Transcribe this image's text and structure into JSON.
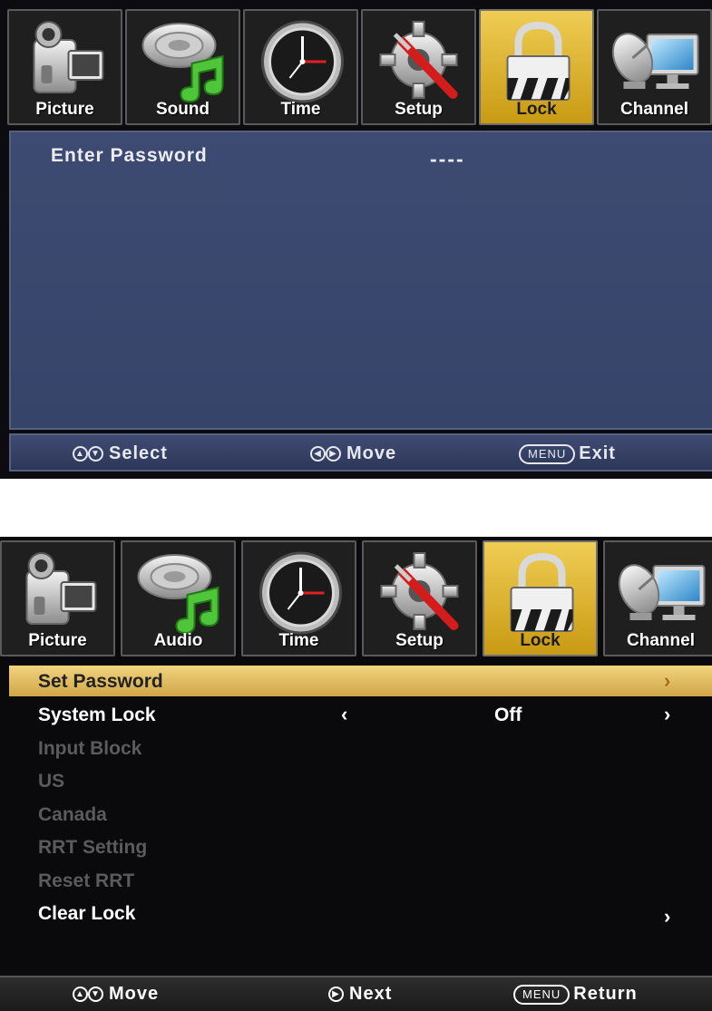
{
  "screen1": {
    "tabs": [
      {
        "label": "Picture",
        "icon": "camcorder-icon"
      },
      {
        "label": "Sound",
        "icon": "speaker-music-note-icon"
      },
      {
        "label": "Time",
        "icon": "clock-icon"
      },
      {
        "label": "Setup",
        "icon": "gear-screwdriver-icon"
      },
      {
        "label": "Lock",
        "icon": "padlock-icon"
      },
      {
        "label": "Channel",
        "icon": "satellite-dish-monitor-icon"
      }
    ],
    "active_tab": "Lock",
    "password_label": "Enter Password",
    "password_value": "----",
    "footer": [
      {
        "icons": "up-down-icon",
        "text": "Select"
      },
      {
        "icons": "left-right-icon",
        "text": "Move"
      },
      {
        "key": "MENU",
        "text": "Exit"
      }
    ]
  },
  "screen2": {
    "tabs": [
      {
        "label": "Picture",
        "icon": "camcorder-icon"
      },
      {
        "label": "Audio",
        "icon": "speaker-music-note-icon"
      },
      {
        "label": "Time",
        "icon": "clock-icon"
      },
      {
        "label": "Setup",
        "icon": "gear-screwdriver-icon"
      },
      {
        "label": "Lock",
        "icon": "padlock-icon"
      },
      {
        "label": "Channel",
        "icon": "satellite-dish-monitor-icon"
      }
    ],
    "active_tab": "Lock",
    "menu": [
      {
        "label": "Set Password",
        "state": "selected",
        "right_arrow": "›"
      },
      {
        "label": "System Lock",
        "state": "enabled",
        "left_arrow": "‹",
        "value": "Off",
        "right_arrow": "›"
      },
      {
        "label": "Input Block",
        "state": "disabled"
      },
      {
        "label": "US",
        "state": "disabled"
      },
      {
        "label": "Canada",
        "state": "disabled"
      },
      {
        "label": "RRT Setting",
        "state": "disabled"
      },
      {
        "label": "Reset RRT",
        "state": "disabled"
      },
      {
        "label": "Clear Lock",
        "state": "enabled",
        "right_arrow": "›"
      }
    ],
    "footer": [
      {
        "icons": "up-down-icon",
        "text": "Move"
      },
      {
        "icons": "right-icon",
        "text": "Next"
      },
      {
        "key": "MENU",
        "text": "Return"
      }
    ]
  },
  "colors": {
    "active_tab": "#e2b834",
    "panel_blue": "#3b4970",
    "selected_row": "#e6c468",
    "disabled_text": "#5b5b5b"
  }
}
